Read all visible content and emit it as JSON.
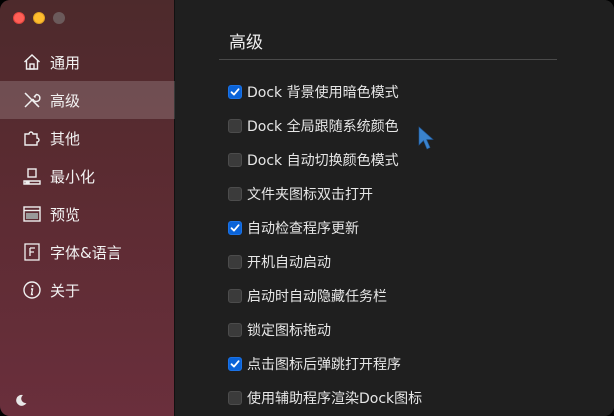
{
  "sidebar": {
    "items": [
      {
        "label": "通用",
        "icon": "home-icon",
        "active": false
      },
      {
        "label": "高级",
        "icon": "tools-icon",
        "active": true
      },
      {
        "label": "其他",
        "icon": "puzzle-icon",
        "active": false
      },
      {
        "label": "最小化",
        "icon": "minimize-icon",
        "active": false
      },
      {
        "label": "预览",
        "icon": "preview-icon",
        "active": false
      },
      {
        "label": "字体&语言",
        "icon": "font-icon",
        "active": false
      },
      {
        "label": "关于",
        "icon": "info-icon",
        "active": false
      }
    ],
    "footer_icon": "moon-icon"
  },
  "main": {
    "title": "高级",
    "options": [
      {
        "label": "Dock 背景使用暗色模式",
        "checked": true
      },
      {
        "label": "Dock 全局跟随系统颜色",
        "checked": false
      },
      {
        "label": "Dock 自动切换颜色模式",
        "checked": false
      },
      {
        "label": "文件夹图标双击打开",
        "checked": false
      },
      {
        "label": "自动检查程序更新",
        "checked": true
      },
      {
        "label": "开机自动启动",
        "checked": false
      },
      {
        "label": "启动时自动隐藏任务栏",
        "checked": false
      },
      {
        "label": "锁定图标拖动",
        "checked": false
      },
      {
        "label": "点击图标后弹跳打开程序",
        "checked": true
      },
      {
        "label": "使用辅助程序渲染Dock图标",
        "checked": false
      }
    ]
  },
  "colors": {
    "accent": "#0a63d8",
    "sidebar_top": "#4d2a2c",
    "sidebar_bottom": "#6a2f3c",
    "content_bg": "#1f1f1f"
  }
}
